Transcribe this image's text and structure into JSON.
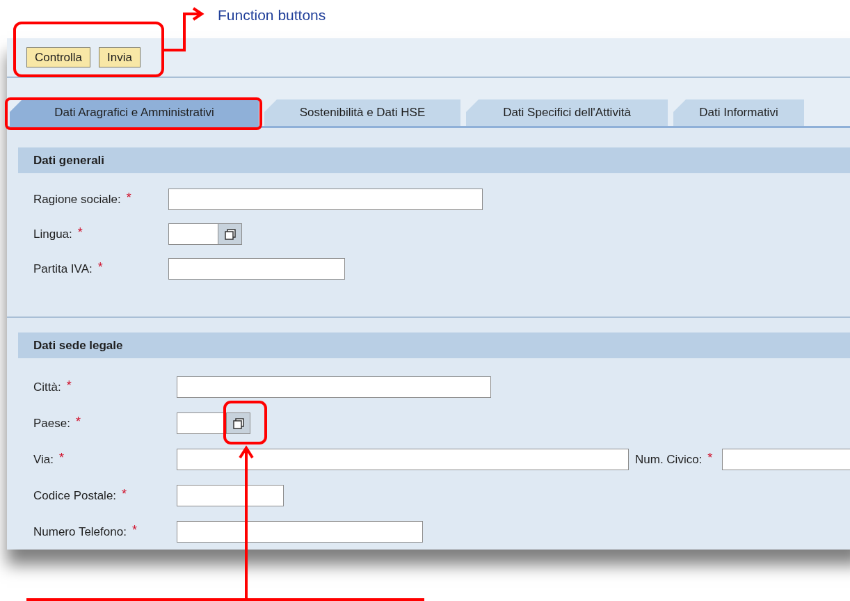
{
  "annotation": {
    "label": "Function buttons"
  },
  "toolbar": {
    "buttons": [
      "Controlla",
      "Invia"
    ]
  },
  "tabs": [
    {
      "label": "Dati Aragrafici e Amministrativi",
      "selected": true
    },
    {
      "label": "Sostenibilità e Dati HSE",
      "selected": false
    },
    {
      "label": "Dati Specifici dell'Attività",
      "selected": false
    },
    {
      "label": "Dati Informativi",
      "selected": false
    }
  ],
  "required_mark": "*",
  "sections": [
    {
      "title": "Dati generali",
      "fields": [
        {
          "label": "Ragione sociale:",
          "required": true,
          "kind": "text"
        },
        {
          "label": "Lingua:",
          "required": true,
          "kind": "lookup"
        },
        {
          "label": "Partita IVA:",
          "required": true,
          "kind": "text"
        }
      ]
    },
    {
      "title": "Dati sede legale",
      "fields": [
        {
          "label": "Città:",
          "required": true,
          "kind": "text"
        },
        {
          "label": "Paese:",
          "required": true,
          "kind": "lookup"
        },
        {
          "label": "Via:",
          "required": true,
          "kind": "text",
          "extra": {
            "label": "Num. Civico:",
            "required": true
          }
        },
        {
          "label": "Codice Postale:",
          "required": true,
          "kind": "text"
        },
        {
          "label": "Numero Telefono:",
          "required": true,
          "kind": "text"
        }
      ]
    }
  ]
}
